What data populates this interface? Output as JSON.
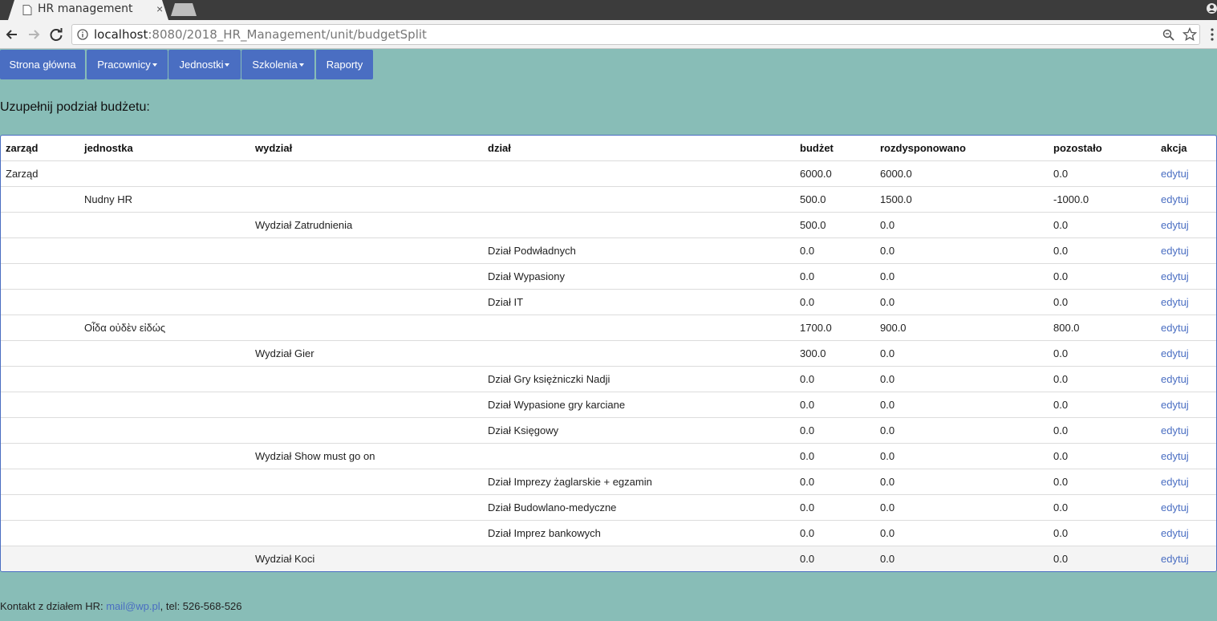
{
  "browser": {
    "tab_title": "HR management",
    "tab_close": "×",
    "url_host": "localhost",
    "url_rest": ":8080/2018_HR_Management/unit/budgetSplit"
  },
  "nav": [
    {
      "label": "Strona główna",
      "dropdown": false
    },
    {
      "label": "Pracownicy",
      "dropdown": true
    },
    {
      "label": "Jednostki",
      "dropdown": true
    },
    {
      "label": "Szkolenia",
      "dropdown": true
    },
    {
      "label": "Raporty",
      "dropdown": false
    }
  ],
  "page": {
    "heading": "Uzupełnij podział budżetu:"
  },
  "table": {
    "columns": [
      "zarząd",
      "jednostka",
      "wydział",
      "dział",
      "budżet",
      "rozdysponowano",
      "pozostało",
      "akcja"
    ],
    "rows": [
      [
        "Zarząd",
        "",
        "",
        "",
        "6000.0",
        "6000.0",
        "0.0",
        "edytuj"
      ],
      [
        "",
        "Nudny HR",
        "",
        "",
        "500.0",
        "1500.0",
        "-1000.0",
        "edytuj"
      ],
      [
        "",
        "",
        "Wydział Zatrudnienia",
        "",
        "500.0",
        "0.0",
        "0.0",
        "edytuj"
      ],
      [
        "",
        "",
        "",
        "Dział Podwładnych",
        "0.0",
        "0.0",
        "0.0",
        "edytuj"
      ],
      [
        "",
        "",
        "",
        "Dział Wypasiony",
        "0.0",
        "0.0",
        "0.0",
        "edytuj"
      ],
      [
        "",
        "",
        "",
        "Dział IT",
        "0.0",
        "0.0",
        "0.0",
        "edytuj"
      ],
      [
        "",
        "Οἶδα οὐδὲν εἰδώς",
        "",
        "",
        "1700.0",
        "900.0",
        "800.0",
        "edytuj"
      ],
      [
        "",
        "",
        "Wydział Gier",
        "",
        "300.0",
        "0.0",
        "0.0",
        "edytuj"
      ],
      [
        "",
        "",
        "",
        "Dział Gry księżniczki Nadji",
        "0.0",
        "0.0",
        "0.0",
        "edytuj"
      ],
      [
        "",
        "",
        "",
        "Dział Wypasione gry karciane",
        "0.0",
        "0.0",
        "0.0",
        "edytuj"
      ],
      [
        "",
        "",
        "",
        "Dział Księgowy",
        "0.0",
        "0.0",
        "0.0",
        "edytuj"
      ],
      [
        "",
        "",
        "Wydział Show must go on",
        "",
        "0.0",
        "0.0",
        "0.0",
        "edytuj"
      ],
      [
        "",
        "",
        "",
        "Dział Imprezy żaglarskie + egzamin",
        "0.0",
        "0.0",
        "0.0",
        "edytuj"
      ],
      [
        "",
        "",
        "",
        "Dział Budowlano-medyczne",
        "0.0",
        "0.0",
        "0.0",
        "edytuj"
      ],
      [
        "",
        "",
        "",
        "Dział Imprez bankowych",
        "0.0",
        "0.0",
        "0.0",
        "edytuj"
      ],
      [
        "",
        "",
        "Wydział Koci",
        "",
        "0.0",
        "0.0",
        "0.0",
        "edytuj"
      ]
    ]
  },
  "footer": {
    "prefix": "Kontakt z działem HR: ",
    "email": "mail@wp.pl",
    "suffix": ", tel: 526-568-526"
  }
}
